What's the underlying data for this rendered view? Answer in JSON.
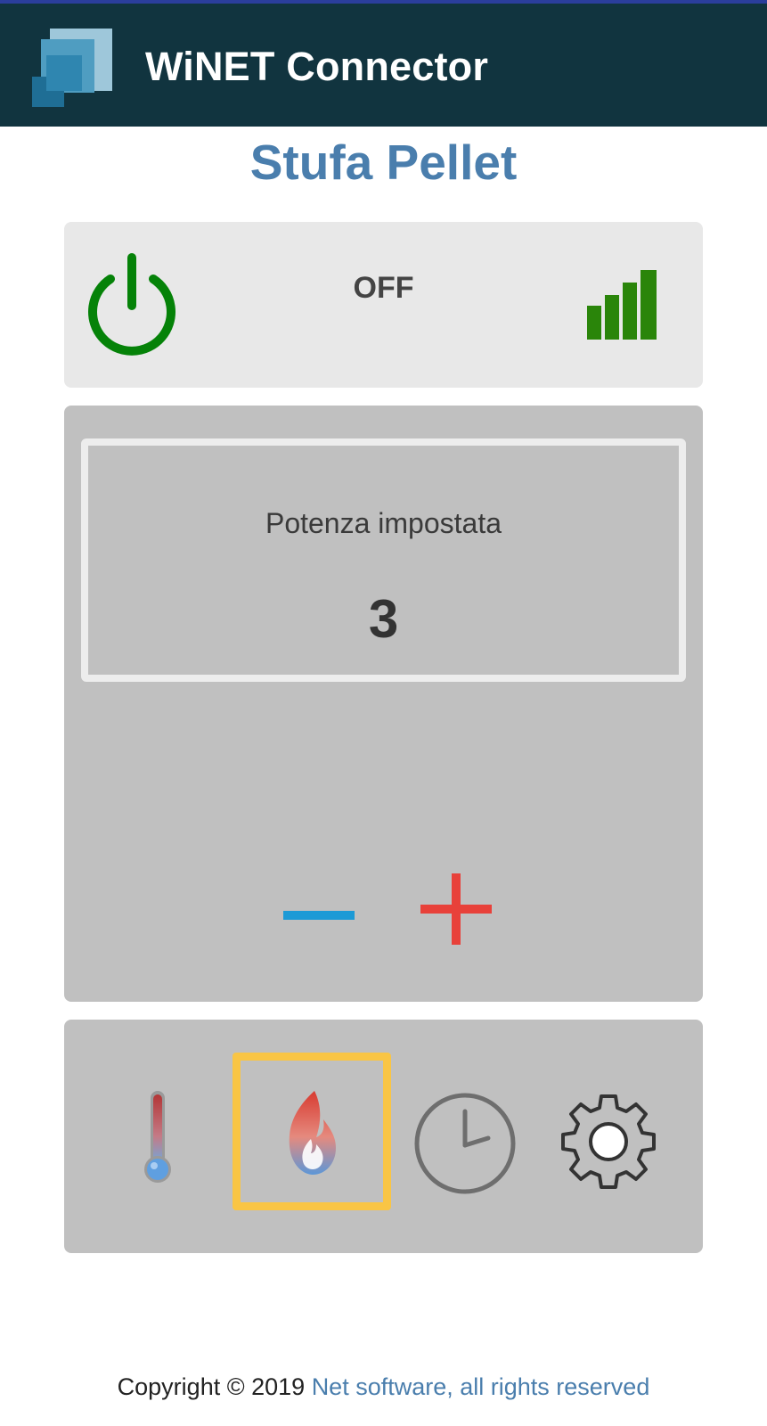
{
  "header": {
    "app_title": "WiNET Connector",
    "logo_icon": "winet-logo-icon",
    "background": "#11343f"
  },
  "page": {
    "title": "Stufa Pellet"
  },
  "status": {
    "power_icon": "power-icon",
    "power_color": "#058208",
    "state": "OFF",
    "signal_icon": "signal-strength-icon",
    "signal_bars_lit": 4,
    "signal_bars_total": 4
  },
  "power_setting": {
    "label": "Potenza impostata",
    "value": "3",
    "decrease_icon": "minus-icon",
    "decrease_color": "#1c9ad6",
    "increase_icon": "plus-icon",
    "increase_color": "#e8413a"
  },
  "nav": {
    "items": [
      {
        "name": "temperature",
        "icon": "thermometer-icon",
        "active": false
      },
      {
        "name": "power",
        "icon": "flame-icon",
        "active": true
      },
      {
        "name": "schedule",
        "icon": "clock-icon",
        "active": false
      },
      {
        "name": "settings",
        "icon": "gear-icon",
        "active": false
      }
    ],
    "active_border_color": "#f9c545"
  },
  "footer": {
    "prefix": "Copyright © 2019 ",
    "link_text": "Net software, all rights reserved"
  }
}
